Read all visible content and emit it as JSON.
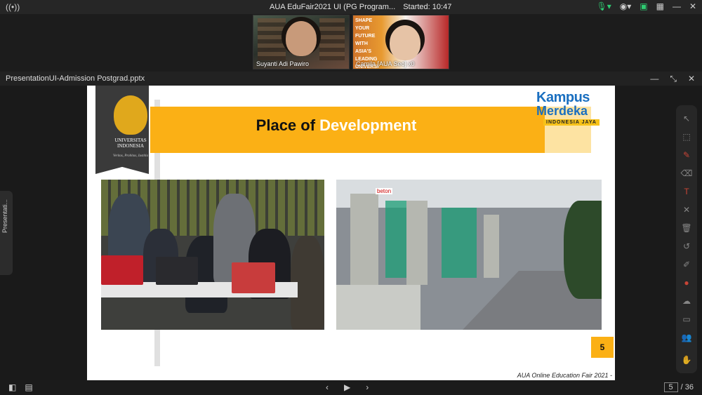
{
  "app": {
    "meeting_title": "AUA EduFair2021 UI (PG Program...",
    "started_label": "Started: 10:47"
  },
  "participants": [
    {
      "name": "Suyanti Adi Pawiro"
    },
    {
      "name": "Camila [AUA Sec]",
      "overlay_text": [
        "SHAPE",
        "YOUR",
        "FUTURE",
        "WITH",
        "ASIA'S",
        "LEADING",
        "UNIVERSI"
      ],
      "suffix": "x0"
    }
  ],
  "presentation": {
    "file_name": "PresentationUI-Admission Postgrad.pptx",
    "side_tab_label": "Presentati...",
    "slide": {
      "title_part1": "Place of ",
      "title_part2": "Development",
      "university_name": "UNIVERSITAS INDONESIA",
      "university_motto": "Veritas, Probitas, Iustitia",
      "kampus_line1": "Kampus",
      "kampus_line2": "Merdeka",
      "kampus_line3": "INDONESIA JAYA",
      "page_number": "5",
      "footer": "AUA Online Education Fair 2021 -",
      "photo_sign_text": "beton"
    }
  },
  "pagination": {
    "current": "5",
    "total": "/ 36"
  },
  "colors": {
    "banner_yellow": "#fbb015",
    "kampus_blue": "#1a6fc0",
    "mic_green": "#2ecc71"
  }
}
